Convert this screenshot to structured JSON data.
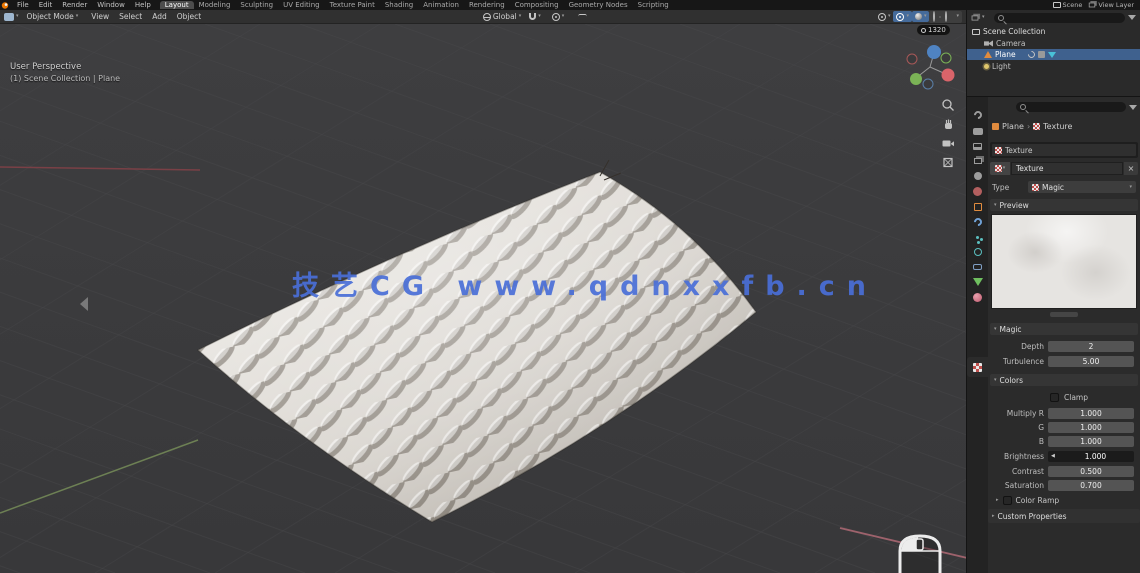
{
  "topbar": {
    "menus": [
      "File",
      "Edit",
      "Render",
      "Window",
      "Help"
    ],
    "workspaces": [
      "Layout",
      "Modeling",
      "Sculpting",
      "UV Editing",
      "Texture Paint",
      "Shading",
      "Animation",
      "Rendering",
      "Compositing",
      "Geometry Nodes",
      "Scripting"
    ],
    "active_workspace": "Layout",
    "scene_selector": "Scene",
    "view_layer_selector": "View Layer"
  },
  "viewport_header": {
    "mode": "Object Mode",
    "menus": [
      "View",
      "Select",
      "Add",
      "Object"
    ],
    "orientation": "Global"
  },
  "viewport": {
    "perspective_label": "User Perspective",
    "collection_label": "(1) Scene Collection | Plane",
    "watermark": "技艺CG www.qdnxxfb.cn",
    "timestamp_badge": "1320"
  },
  "outliner": {
    "items": [
      {
        "label": "Scene Collection"
      },
      {
        "label": "Camera"
      },
      {
        "label": "Plane"
      },
      {
        "label": "Light"
      }
    ]
  },
  "properties": {
    "breadcrumb": {
      "object": "Plane",
      "data": "Texture"
    },
    "texture_slot": "Texture",
    "datablock_name": "Texture",
    "type_label": "Type",
    "type_value": "Magic",
    "preview_panel_title": "Preview",
    "magic_panel": {
      "title": "Magic",
      "depth_label": "Depth",
      "depth_value": "2",
      "turbulence_label": "Turbulence",
      "turbulence_value": "5.00"
    },
    "colors_panel": {
      "title": "Colors",
      "clamp_label": "Clamp",
      "multiply_r_label": "Multiply R",
      "multiply_r": "1.000",
      "g_label": "G",
      "g": "1.000",
      "b_label": "B",
      "b": "1.000",
      "brightness_label": "Brightness",
      "brightness": "1.000",
      "contrast_label": "Contrast",
      "contrast": "0.500",
      "saturation_label": "Saturation",
      "saturation": "0.700",
      "color_ramp_label": "Color Ramp"
    },
    "custom_properties_label": "Custom Properties"
  },
  "icons": {
    "search": "magnifier",
    "filter": "funnel",
    "snap": "magnet",
    "orientation": "globe",
    "shading_active": "solid-sphere",
    "active_properties_tab": "texture-checker"
  },
  "colors": {
    "selection_blue": "#3f618e",
    "watermark_blue": "#4a6fd8",
    "axis_red": "#7a4046",
    "axis_green": "#6d8054",
    "header_bg": "#303030",
    "panel_bg": "#2b2b2b"
  }
}
